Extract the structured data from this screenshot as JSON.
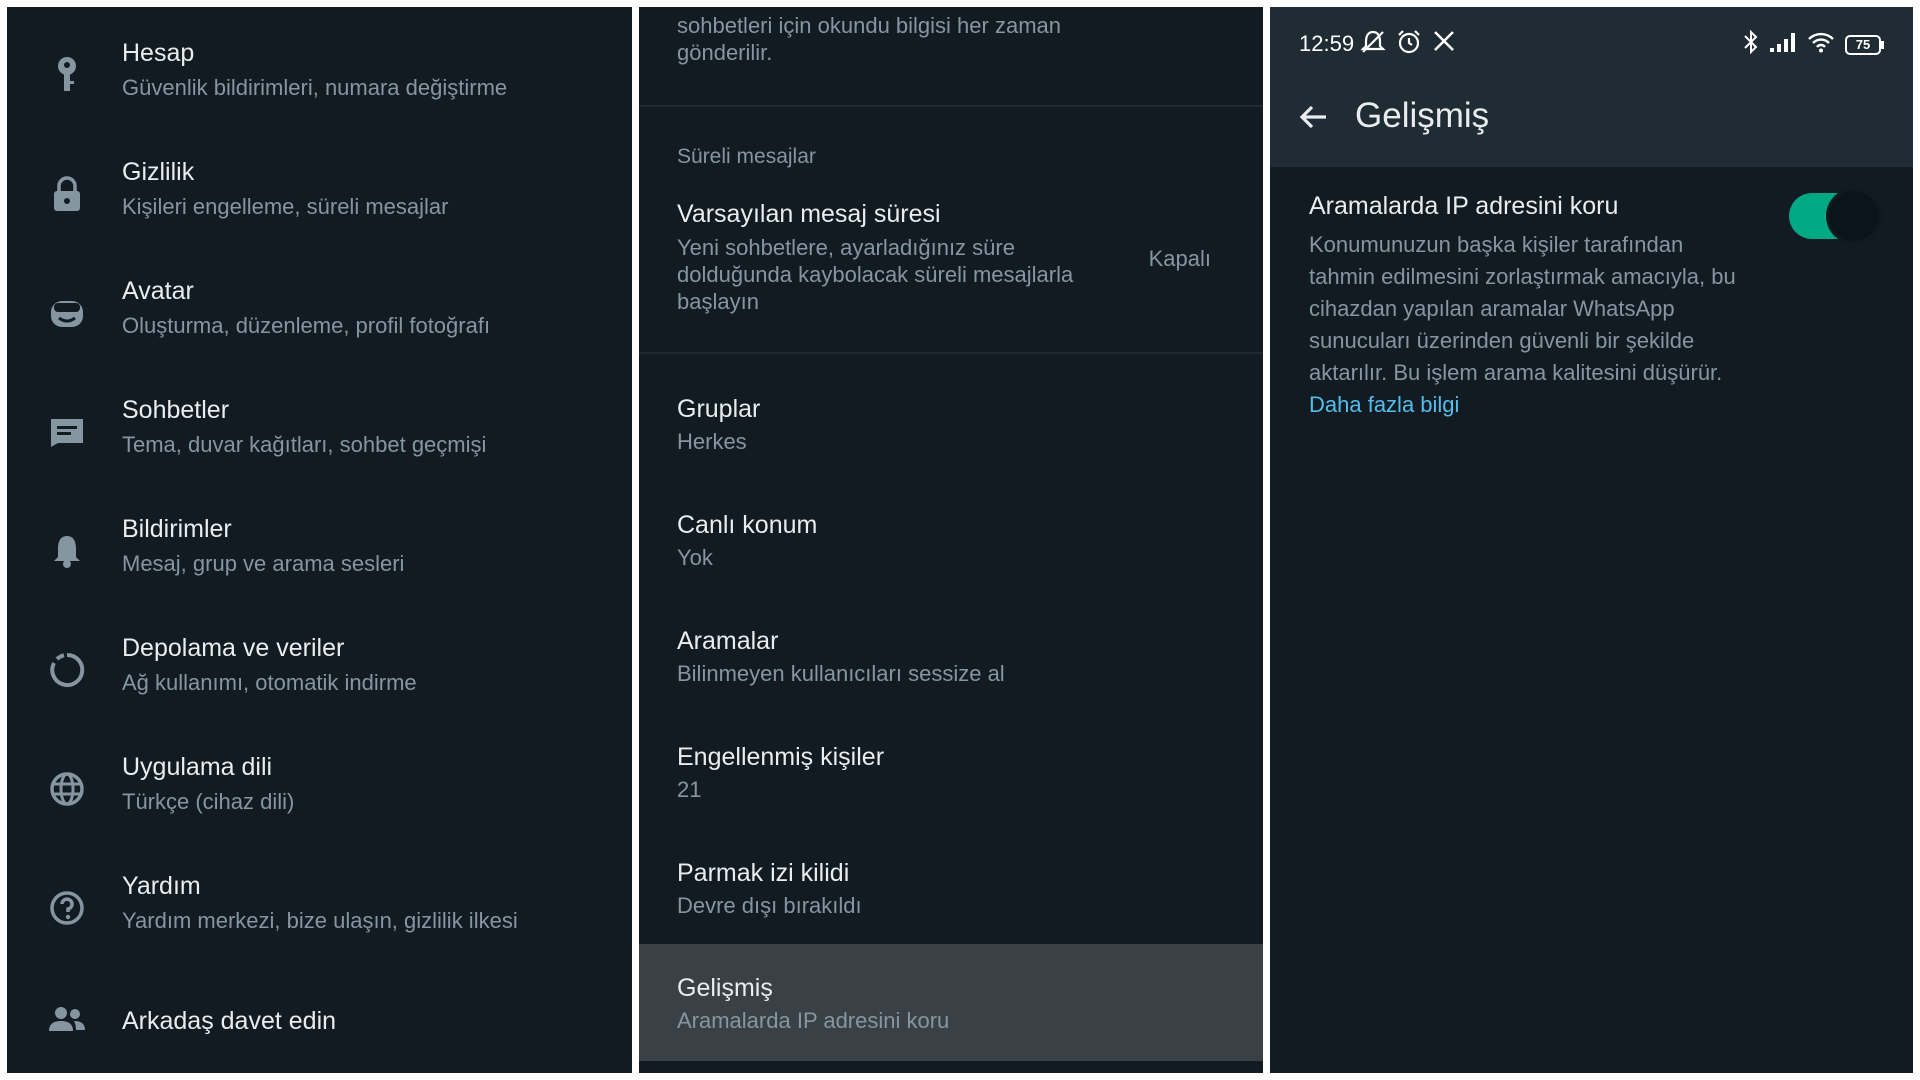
{
  "colors": {
    "background": "#121b22",
    "appbar": "#1f2c33",
    "primary_text": "#e9edef",
    "secondary_text": "#8696a0",
    "accent_green": "#00a884",
    "link_blue": "#53bdeb",
    "selected_row": "#3a4146"
  },
  "settings_menu": {
    "items": [
      {
        "icon": "key-icon",
        "title": "Hesap",
        "subtitle": "Güvenlik bildirimleri, numara değiştirme"
      },
      {
        "icon": "lock-icon",
        "title": "Gizlilik",
        "subtitle": "Kişileri engelleme, süreli mesajlar"
      },
      {
        "icon": "avatar-face-icon",
        "title": "Avatar",
        "subtitle": "Oluşturma, düzenleme, profil fotoğrafı"
      },
      {
        "icon": "chat-icon",
        "title": "Sohbetler",
        "subtitle": "Tema, duvar kağıtları, sohbet geçmişi"
      },
      {
        "icon": "bell-icon",
        "title": "Bildirimler",
        "subtitle": "Mesaj, grup ve arama sesleri"
      },
      {
        "icon": "storage-circle-icon",
        "title": "Depolama ve veriler",
        "subtitle": "Ağ kullanımı, otomatik indirme"
      },
      {
        "icon": "globe-icon",
        "title": "Uygulama dili",
        "subtitle": "Türkçe (cihaz dili)"
      },
      {
        "icon": "help-icon",
        "title": "Yardım",
        "subtitle": "Yardım merkezi, bize ulaşın, gizlilik ilkesi"
      },
      {
        "icon": "people-icon",
        "title": "Arkadaş davet edin",
        "subtitle": ""
      }
    ]
  },
  "privacy": {
    "top_text_line1": "sohbetleri için okundu bilgisi her zaman",
    "top_text_line2": "gönderilir.",
    "section_label": "Süreli mesajlar",
    "default_timer": {
      "title": "Varsayılan mesaj süresi",
      "description": "Yeni sohbetlere, ayarladığınız süre dolduğunda kaybolacak süreli mesajlarla başlayın",
      "value": "Kapalı"
    },
    "items": [
      {
        "title": "Gruplar",
        "subtitle": "Herkes"
      },
      {
        "title": "Canlı konum",
        "subtitle": "Yok"
      },
      {
        "title": "Aramalar",
        "subtitle": "Bilinmeyen kullanıcıları sessize al"
      },
      {
        "title": "Engellenmiş kişiler",
        "subtitle": "21"
      },
      {
        "title": "Parmak izi kilidi",
        "subtitle": "Devre dışı bırakıldı"
      },
      {
        "title": "Gelişmiş",
        "subtitle": "Aramalarda IP adresini koru"
      }
    ]
  },
  "advanced": {
    "status_bar": {
      "time": "12:59",
      "battery": "75"
    },
    "title": "Gelişmiş",
    "setting": {
      "title": "Aramalarda IP adresini koru",
      "description": "Konumunuzun başka kişiler tarafından tahmin edilmesini zorlaştırmak amacıyla, bu cihazdan yapılan aramalar WhatsApp sunucuları üzerinden güvenli bir şekilde aktarılır. Bu işlem arama kalitesini düşürür.",
      "link": "Daha fazla bilgi",
      "enabled": true
    }
  }
}
